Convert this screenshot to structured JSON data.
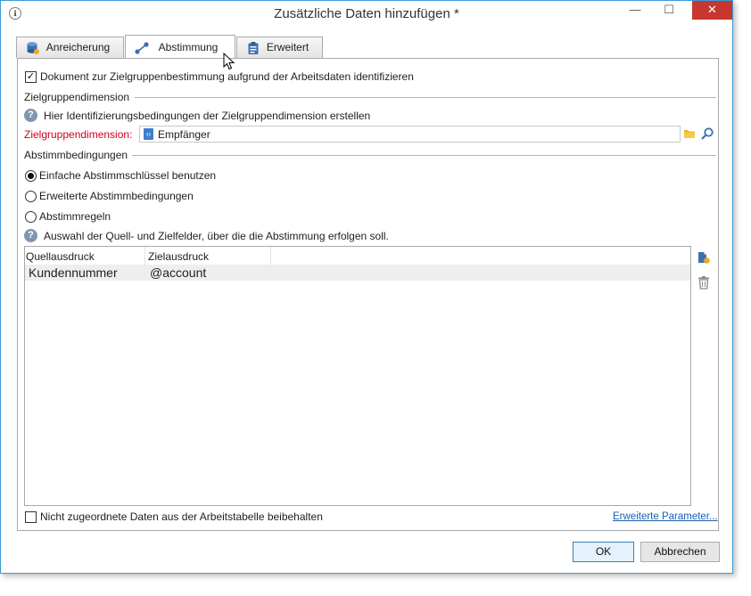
{
  "window": {
    "title": "Zusätzliche Daten hinzufügen *",
    "app_icon_glyph": "ℹ",
    "minimize_glyph": "—",
    "maximize_glyph": "☐",
    "close_glyph": "✕"
  },
  "tabs": [
    {
      "label": "Anreicherung",
      "icon": "database-icon",
      "active": false
    },
    {
      "label": "Abstimmung",
      "icon": "link-nodes-icon",
      "active": true
    },
    {
      "label": "Erweitert",
      "icon": "clipboard-icon",
      "active": false
    }
  ],
  "identify_checkbox": {
    "label": "Dokument zur Zielgruppenbestimmung aufgrund der Arbeitsdaten identifizieren",
    "checked": true,
    "check_glyph": "✓"
  },
  "target_dimension_section": {
    "title": "Zielgruppendimension",
    "help_text": "Hier Identifizierungsbedingungen der Zielgruppendimension erstellen",
    "field_label": "Zielgruppendimension:",
    "field_value": "Empfänger"
  },
  "conditions_section": {
    "title": "Abstimmbedingungen",
    "options": [
      {
        "label": "Einfache Abstimmschlüssel benutzen",
        "selected": true
      },
      {
        "label": "Erweiterte Abstimmbedingungen",
        "selected": false
      },
      {
        "label": "Abstimmregeln",
        "selected": false
      }
    ],
    "help_text": "Auswahl der Quell- und Zielfelder, über die die Abstimmung erfolgen soll."
  },
  "grid": {
    "columns": [
      "Quellausdruck",
      "Zielausdruck"
    ],
    "rows": [
      {
        "source": "Kundennummer",
        "target": "@account"
      }
    ]
  },
  "footer": {
    "keep_unmatched_label": "Nicht zugeordnete Daten aus der Arbeitstabelle beibehalten",
    "keep_unmatched_checked": false,
    "advanced_link": "Erweiterte Parameter...",
    "ok_label": "OK",
    "cancel_label": "Abbrechen"
  },
  "colors": {
    "accent_border": "#3a9ad9",
    "close_button": "#c7372f",
    "required_label": "#d0021b",
    "link": "#1a5fb4",
    "help_icon": "#7f96b1"
  }
}
